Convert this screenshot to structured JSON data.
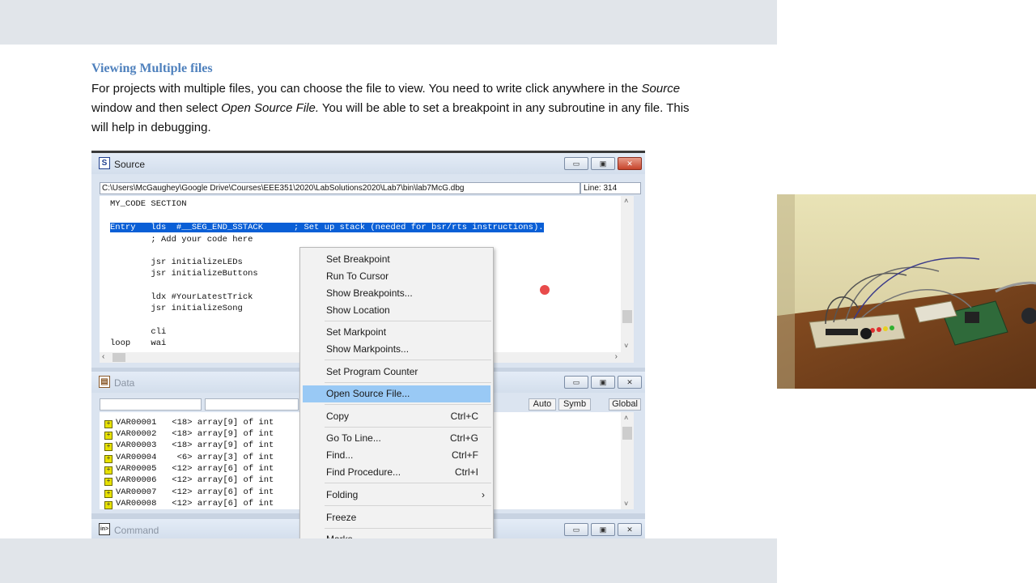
{
  "doc": {
    "heading": "Viewing Multiple files",
    "para_1": "For projects with multiple files, you can choose the file to view.  You need to write click anywhere in the ",
    "para_em_1": "Source",
    "para_2": " window and then select ",
    "para_em_2": "Open Source File.",
    "para_3": "   You will be able to set a breakpoint in any subroutine in any file.  This will help in debugging."
  },
  "source_window": {
    "title": "Source",
    "path": "C:\\Users\\McGaughey\\Google Drive\\Courses\\EEE351\\2020\\LabSolutions2020\\Lab7\\bin\\lab7McG.dbg",
    "line_label": "Line: 314",
    "code_lines": [
      "MY_CODE SECTION",
      "",
      "Entry   lds  #__SEG_END_SSTACK      ; Set up stack (needed for bsr/rts instructions).",
      "        ; Add your code here",
      "",
      "        jsr initializeLEDs",
      "        jsr initializeButtons",
      "",
      "        ldx #YourLatestTrick",
      "        jsr initializeSong",
      "",
      "        cli",
      "loop    wai"
    ]
  },
  "data_window": {
    "title": "Data",
    "buttons": [
      "Auto",
      "Symb",
      "Global"
    ],
    "rows": [
      "VAR00001   <18> array[9] of int",
      "VAR00002   <18> array[9] of int",
      "VAR00003   <18> array[9] of int",
      "VAR00004    <6> array[3] of int",
      "VAR00005   <12> array[6] of int",
      "VAR00006   <12> array[6] of int",
      "VAR00007   <12> array[6] of int",
      "VAR00008   <12> array[6] of int"
    ]
  },
  "command_window": {
    "title": "Command"
  },
  "context_menu": {
    "items": [
      {
        "label": "Set Breakpoint",
        "shortcut": ""
      },
      {
        "label": "Run To Cursor",
        "shortcut": ""
      },
      {
        "label": "Show Breakpoints...",
        "shortcut": ""
      },
      {
        "label": "Show Location",
        "shortcut": ""
      },
      {
        "label": "Set Markpoint",
        "shortcut": ""
      },
      {
        "label": "Show Markpoints...",
        "shortcut": ""
      },
      {
        "label": "Set Program Counter",
        "shortcut": ""
      },
      {
        "label": "Open Source File...",
        "shortcut": ""
      },
      {
        "label": "Copy",
        "shortcut": "Ctrl+C"
      },
      {
        "label": "Go To Line...",
        "shortcut": "Ctrl+G"
      },
      {
        "label": "Find...",
        "shortcut": "Ctrl+F"
      },
      {
        "label": "Find Procedure...",
        "shortcut": "Ctrl+I"
      },
      {
        "label": "Folding",
        "shortcut": "›"
      },
      {
        "label": "Freeze",
        "shortcut": ""
      },
      {
        "label": "Marks",
        "shortcut": ""
      }
    ],
    "highlighted": "Open Source File..."
  },
  "icons": {
    "source": "source-window-icon",
    "data": "data-window-icon",
    "command": "command-window-icon",
    "minimize": "minimize-icon",
    "maximize": "maximize-icon",
    "close": "close-icon"
  },
  "colors": {
    "heading": "#4f81bd",
    "selection": "#0a5fd6",
    "menu_highlight": "#99c9f5",
    "breakpoint": "#e84b4b"
  }
}
